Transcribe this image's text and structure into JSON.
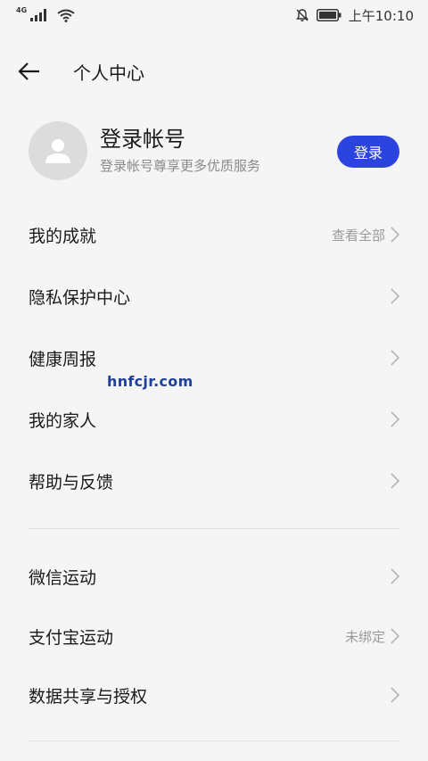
{
  "status_bar": {
    "network": "4G",
    "time": "上午10:10"
  },
  "header": {
    "title": "个人中心"
  },
  "account": {
    "name": "登录帐号",
    "description": "登录帐号尊享更多优质服务",
    "login_label": "登录"
  },
  "menu_group1": [
    {
      "label": "我的成就",
      "extra": "查看全部"
    },
    {
      "label": "隐私保护中心",
      "extra": ""
    },
    {
      "label": "健康周报",
      "extra": ""
    },
    {
      "label": "我的家人",
      "extra": ""
    },
    {
      "label": "帮助与反馈",
      "extra": ""
    }
  ],
  "menu_group2": [
    {
      "label": "微信运动",
      "extra": ""
    },
    {
      "label": "支付宝运动",
      "extra": "未绑定"
    },
    {
      "label": "数据共享与授权",
      "extra": ""
    }
  ],
  "watermark": "hnfcjr.com",
  "colors": {
    "accent": "#2b44e0",
    "background": "#f5f5f5",
    "secondary_text": "#9a9a9a"
  }
}
